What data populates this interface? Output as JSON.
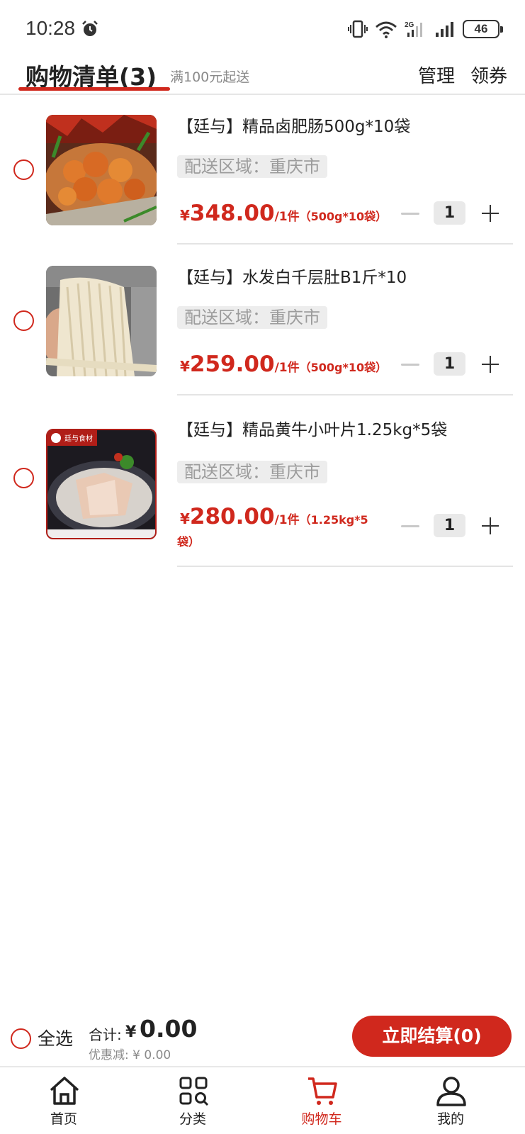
{
  "status_bar": {
    "time": "10:28",
    "network_label": "2G",
    "wifi_label": "6",
    "battery": "46"
  },
  "header": {
    "title": "购物清单(3)",
    "subtitle": "满100元起送",
    "manage": "管理",
    "coupon": "领券"
  },
  "cart": {
    "items": [
      {
        "name": "【廷与】精品卤肥肠500g*10袋",
        "region": "配送区域：重庆市",
        "currency": "¥",
        "price": "348.00",
        "unit": "/1件",
        "spec": "（500g*10袋）",
        "quantity": "1"
      },
      {
        "name": "【廷与】水发白千层肚B1斤*10",
        "region": "配送区域：重庆市",
        "currency": "¥",
        "price": "259.00",
        "unit": "/1件",
        "spec": "（500g*10袋）",
        "quantity": "1"
      },
      {
        "name": "【廷与】精品黄牛小叶片1.25kg*5袋",
        "region": "配送区域：重庆市",
        "currency": "¥",
        "price": "280.00",
        "unit": "/1件",
        "spec_line1": "（1.25kg*5",
        "spec_line2": "袋）",
        "quantity": "1"
      }
    ]
  },
  "checkout": {
    "select_all": "全选",
    "total_label": "合计:",
    "total_currency": "¥",
    "total_value": "0.00",
    "discount": "优惠减: ¥ 0.00",
    "button": "立即结算(0)"
  },
  "nav": {
    "items": [
      {
        "label": "首页",
        "icon": "home-icon"
      },
      {
        "label": "分类",
        "icon": "category-icon"
      },
      {
        "label": "购物车",
        "icon": "cart-icon"
      },
      {
        "label": "我的",
        "icon": "profile-icon"
      }
    ],
    "active": "购物车"
  },
  "colors": {
    "accent": "#d0281d",
    "text": "#222222",
    "muted": "#8a8a8a"
  }
}
